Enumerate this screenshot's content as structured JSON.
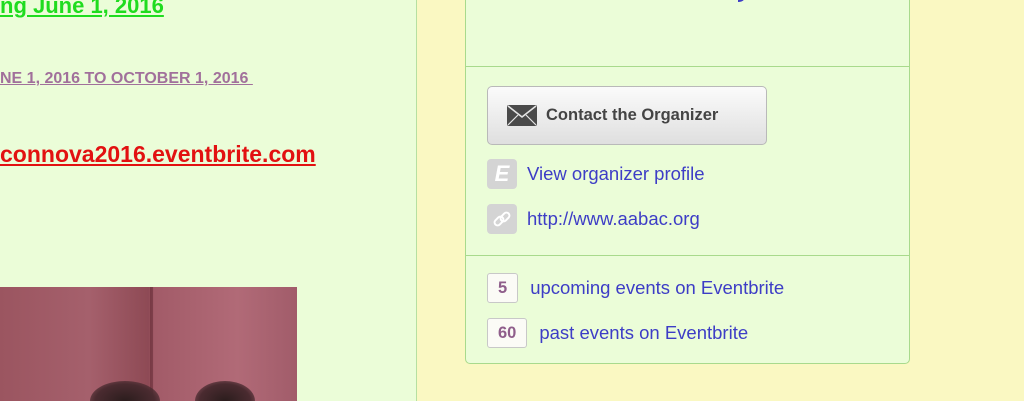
{
  "main": {
    "headline": "ng June 1, 2016",
    "dates": "NE 1, 2016 TO OCTOBER 1, 2016 ",
    "event_url": "connova2016.eventbrite.com"
  },
  "organizer_panel": {
    "contact_button_label": "Contact the Organizer",
    "profile_link": "View organizer profile",
    "profile_icon_letter": "E",
    "website_link": "http://www.aabac.org",
    "upcoming": {
      "count": "5",
      "label": "upcoming events on Eventbrite"
    },
    "past": {
      "count": "60",
      "label": "past events on Eventbrite"
    }
  },
  "colors": {
    "page_bg": "#faf8c2",
    "panel_bg": "#ebfdd8",
    "headline": "#1fdc1f",
    "dates": "#a1709b",
    "url": "#e21111",
    "link": "#3d3dc6"
  },
  "icons": [
    "envelope-icon",
    "eventbrite-e-icon",
    "link-icon"
  ]
}
